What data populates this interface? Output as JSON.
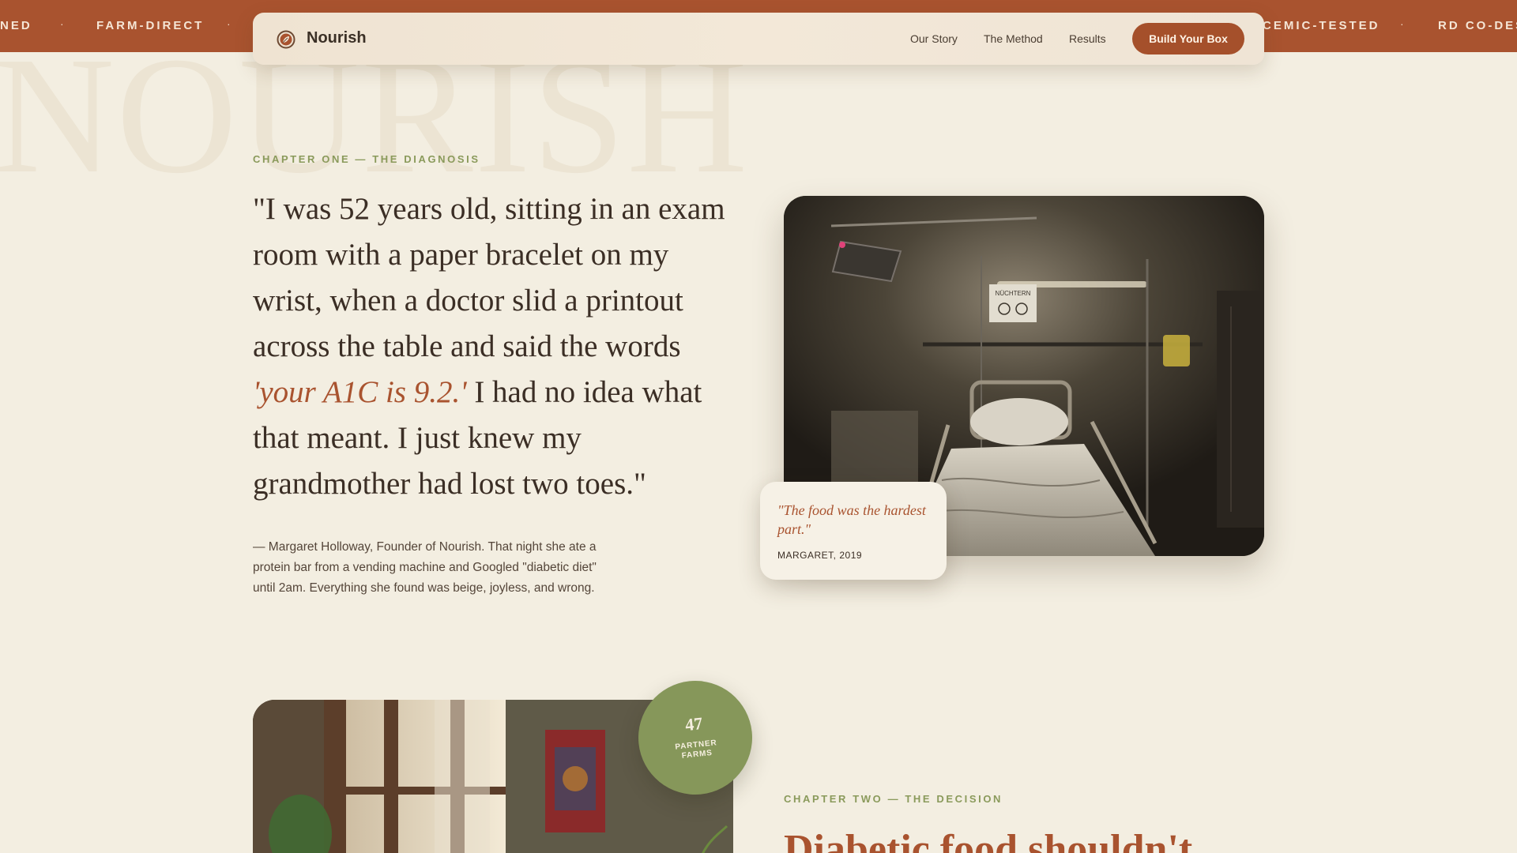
{
  "ticker": {
    "items": [
      "NED",
      "FARM-DIRECT",
      "CEMIC-TESTED",
      "RD CO-DES"
    ],
    "separator": "·"
  },
  "watermark": "NOURISH",
  "nav": {
    "brand": "Nourish",
    "logo_icon": "leaf-seal-icon",
    "links": [
      "Our Story",
      "The Method",
      "Results"
    ],
    "cta": "Build Your Box"
  },
  "chapter_one": {
    "eyebrow": "CHAPTER ONE — THE DIAGNOSIS",
    "quote_before": "\"I was 52 years old, sitting in an exam room with a paper bracelet on my wrist, when a doctor slid a printout across the table and said the words ",
    "quote_highlight": "'your A1C is 9.2.'",
    "quote_after": " I had no idea what that meant. I just knew my grandmother had lost two toes.\"",
    "caption": "— Margaret Holloway, Founder of Nourish. That night she ate a protein bar from a vending machine and Googled \"diabetic diet\" until 2am. Everything she found was beige, joyless, and wrong.",
    "photo": "hospital-bed-photo",
    "sign_text": "NÜCHTERN",
    "note": {
      "quote": "\"The food was the hardest part.\"",
      "attribution": "MARGARET, 2019"
    }
  },
  "chapter_two": {
    "eyebrow": "CHAPTER TWO — THE DECISION",
    "headline": "Diabetic food shouldn't",
    "photo": "kitchen-window-photo",
    "badge": {
      "number": "47",
      "label_line1": "PARTNER",
      "label_line2": "FARMS"
    }
  },
  "colors": {
    "background": "#f3eee1",
    "terracotta": "#a9532f",
    "olive": "#86975a",
    "text": "#3b2e25"
  }
}
